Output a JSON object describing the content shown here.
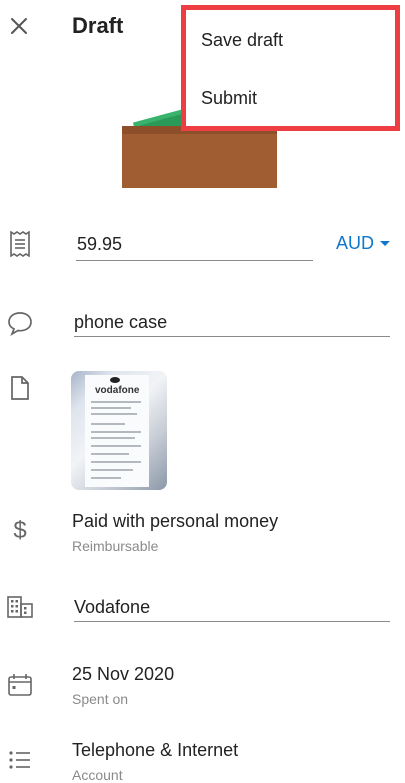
{
  "header": {
    "title": "Draft"
  },
  "menu": {
    "items": [
      "Save draft",
      "Submit"
    ]
  },
  "amount": {
    "value": "59.95",
    "currency": "AUD"
  },
  "description": {
    "value": "phone case"
  },
  "attachment": {
    "brand": "vodafone"
  },
  "payment": {
    "label": "Paid with personal money",
    "sub": "Reimbursable"
  },
  "merchant": {
    "value": "Vodafone"
  },
  "date": {
    "value": "25 Nov 2020",
    "sub": "Spent on"
  },
  "account": {
    "value": "Telephone & Internet",
    "sub": "Account"
  },
  "colors": {
    "accent": "#1177cc",
    "highlight": "#ef3e43",
    "wallet": "#a15d32",
    "cash": "#39b26b"
  }
}
